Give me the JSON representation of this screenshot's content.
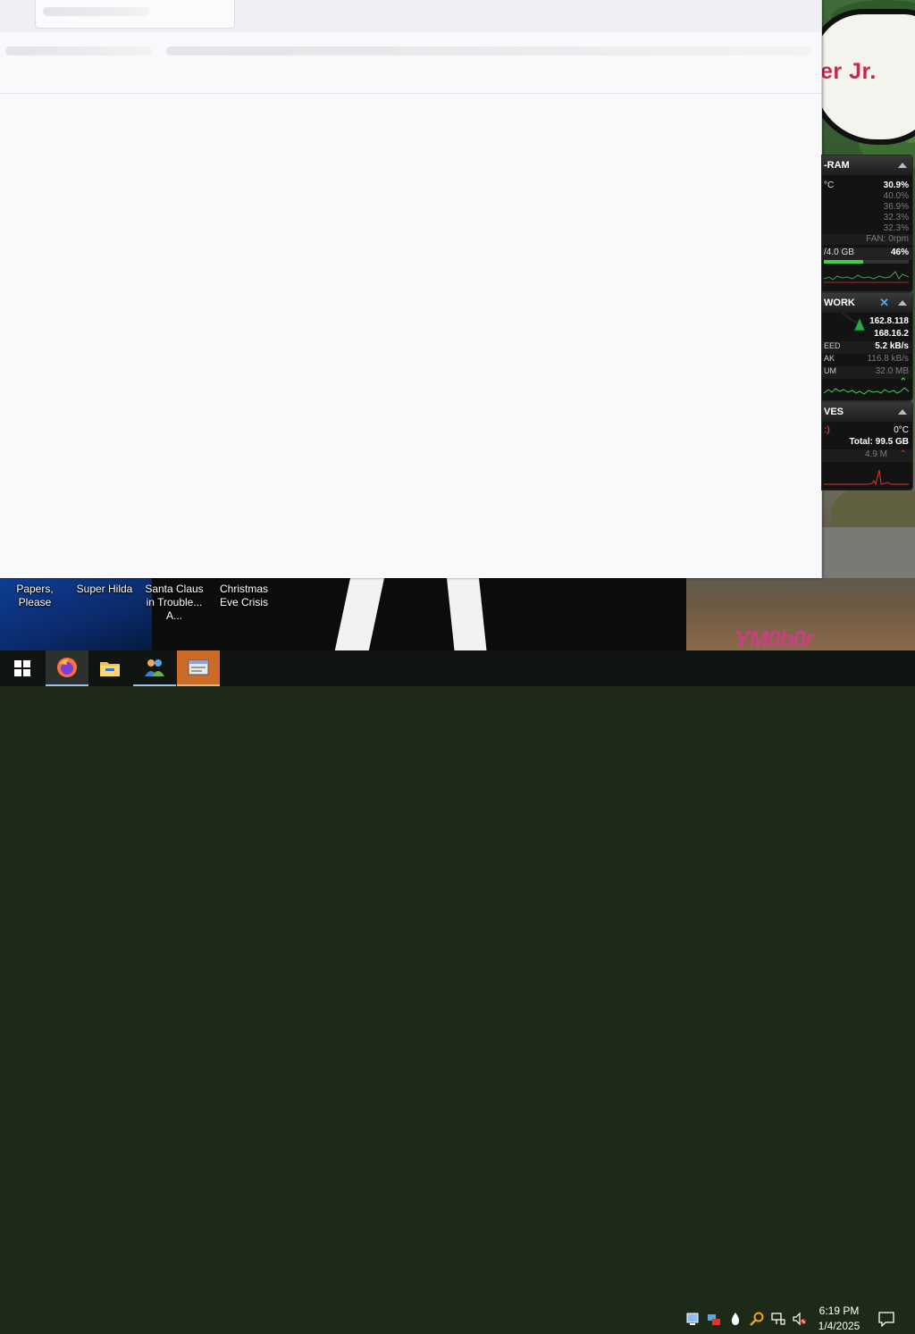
{
  "desktop": {
    "sign_text": "er Jr.",
    "graffiti_text": "YM0b0r",
    "icons": [
      {
        "label": "Papers, Please"
      },
      {
        "label": "Super Hilda"
      },
      {
        "label": "Santa Claus in Trouble... A..."
      },
      {
        "label": "Christmas Eve Crisis"
      }
    ]
  },
  "gadget": {
    "cpu_ram": {
      "title": "-RAM",
      "temp_unit": "°C",
      "usage_total": "30.9%",
      "core_1": "40.0%",
      "core_2": "36.9%",
      "core_3": "32.3%",
      "core_4": "32.3%",
      "fan": "FAN: 0rpm",
      "ram_label": "/4.0 GB",
      "ram_percent": "46%",
      "ram_fill": 0.46
    },
    "network": {
      "title": "WORK",
      "ip_1": "162.8.118",
      "ip_2": "168.16.2",
      "speed_label": "EED",
      "speed_value": "5.2 kB/s",
      "peak_label": "AK",
      "peak_value": "116.8 kB/s",
      "sum_label": "UM",
      "sum_value": "32.0 MB"
    },
    "drives": {
      "title": "VES",
      "drive_label": ":)",
      "temp": "0°C",
      "total": "Total: 99.5 GB",
      "activity": "4.9 M"
    }
  },
  "taskbar": {
    "apps": [
      {
        "name": "firefox",
        "icon": "firefox-icon"
      },
      {
        "name": "file-explorer",
        "icon": "folder-icon"
      },
      {
        "name": "people",
        "icon": "people-icon"
      },
      {
        "name": "active-window",
        "icon": "window-icon"
      }
    ],
    "time": "6:19 PM",
    "date": "1/4/2025"
  },
  "colors": {
    "taskbar_bg": "#101412",
    "active_app": "#cc6b28",
    "sign_text": "#c8284b",
    "gadget_green": "#3ed14a",
    "gadget_red": "#e0342a"
  }
}
